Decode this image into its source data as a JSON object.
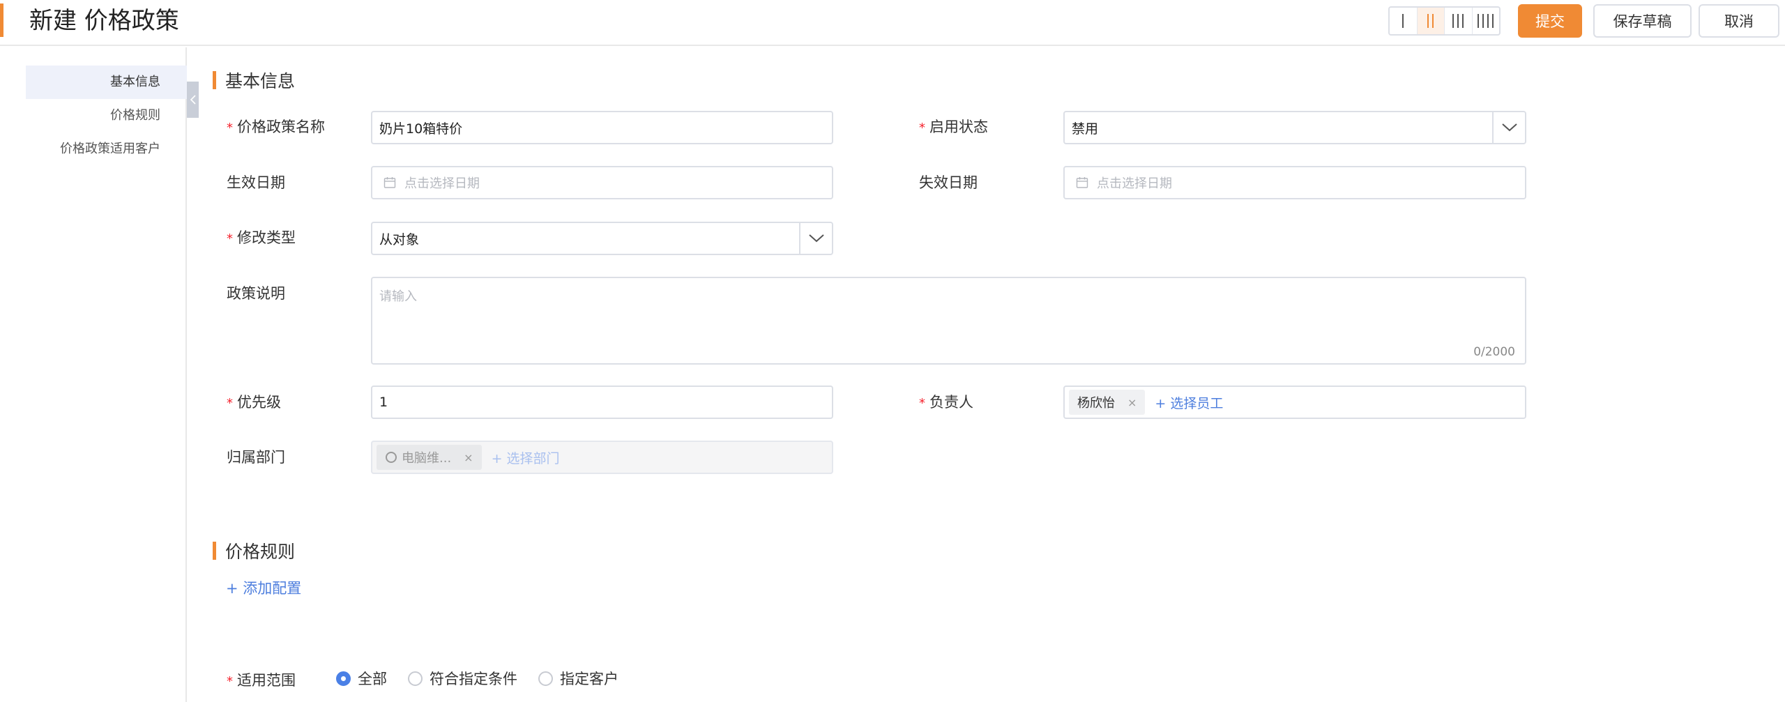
{
  "header": {
    "title": "新建 价格政策",
    "layout_options": [
      "single-column",
      "two-column",
      "three-column",
      "four-column"
    ],
    "active_layout": "two-column",
    "submit_label": "提交",
    "save_draft_label": "保存草稿",
    "cancel_label": "取消"
  },
  "sidebar": {
    "items": [
      {
        "label": "基本信息",
        "active": true
      },
      {
        "label": "价格规则",
        "active": false
      },
      {
        "label": "价格政策适用客户",
        "active": false
      }
    ]
  },
  "sections": {
    "basic": "基本信息",
    "rules": "价格规则"
  },
  "form": {
    "policy_name": {
      "label": "价格政策名称",
      "value": "奶片10箱特价",
      "required": true
    },
    "status": {
      "label": "启用状态",
      "value": "禁用",
      "required": true
    },
    "start_date": {
      "label": "生效日期",
      "placeholder": "点击选择日期"
    },
    "end_date": {
      "label": "失效日期",
      "placeholder": "点击选择日期"
    },
    "modify_type": {
      "label": "修改类型",
      "value": "从对象",
      "required": true
    },
    "description": {
      "label": "政策说明",
      "placeholder": "请输入",
      "count": "0/2000"
    },
    "priority": {
      "label": "优先级",
      "value": "1",
      "required": true
    },
    "owner": {
      "label": "负责人",
      "tag": "杨欣怡",
      "add_label": "+ 选择员工",
      "required": true
    },
    "department": {
      "label": "归属部门",
      "tag": "电脑维...",
      "add_label": "+ 选择部门"
    },
    "add_config_label": "+ 添加配置",
    "scope": {
      "label": "适用范围",
      "required": true,
      "options": [
        "全部",
        "符合指定条件",
        "指定客户"
      ],
      "selected": "全部"
    }
  },
  "colors": {
    "accent": "#f08a34",
    "link": "#4d7ede",
    "required": "#f5222d"
  }
}
